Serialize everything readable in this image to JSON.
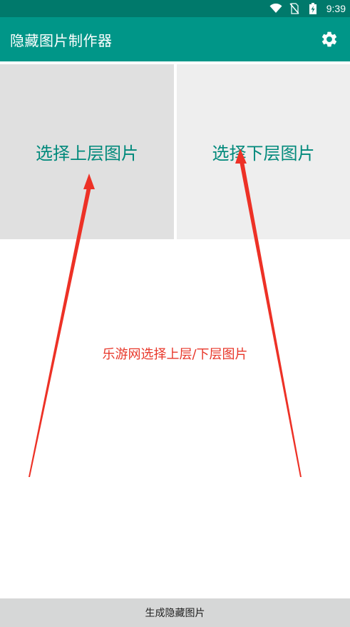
{
  "status_bar": {
    "time": "9:39",
    "icons": [
      "wifi-icon",
      "no-sim-icon",
      "battery-charging-icon"
    ]
  },
  "app_bar": {
    "title": "隐藏图片制作器",
    "settings_icon": "gear-icon"
  },
  "panels": {
    "upper_label": "选择上层图片",
    "lower_label": "选择下层图片"
  },
  "annotation": {
    "text": "乐游网选择上层/下层图片",
    "color": "#e8372a"
  },
  "bottom_button": {
    "label": "生成隐藏图片"
  },
  "colors": {
    "status_bar": "#00796b",
    "app_bar": "#009688",
    "accent_text": "#00897b",
    "panel_upper_bg": "#e0e0e0",
    "panel_lower_bg": "#eeeeee",
    "bottom_button_bg": "#d6d7d7"
  }
}
